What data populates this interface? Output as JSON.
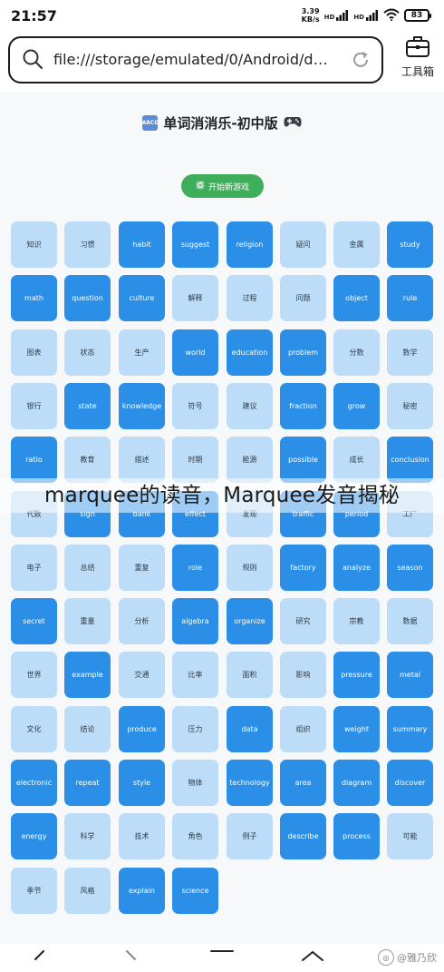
{
  "status_bar": {
    "time": "21:57",
    "net_speed_value": "3.39",
    "net_speed_unit": "KB/s",
    "signal_1": "HD",
    "signal_2": "HD",
    "battery": "83"
  },
  "browser": {
    "url": "file:///storage/emulated/0/Android/d…",
    "toolbox_label": "工具箱"
  },
  "page": {
    "title": "单词消消乐-初中版",
    "abc_icon_text": "ABCD",
    "new_game_label": "开始新游戏"
  },
  "colors": {
    "card_light": "#bddcf7",
    "card_blue": "#2b8fe8",
    "new_game_green": "#3fae5a"
  },
  "grid": {
    "rows": [
      [
        {
          "t": "知识",
          "s": "light"
        },
        {
          "t": "习惯",
          "s": "light"
        },
        {
          "t": "habit",
          "s": "blue"
        },
        {
          "t": "suggest",
          "s": "blue"
        },
        {
          "t": "religion",
          "s": "blue"
        },
        {
          "t": "疑问",
          "s": "light"
        },
        {
          "t": "金属",
          "s": "light"
        },
        {
          "t": "study",
          "s": "blue"
        }
      ],
      [
        {
          "t": "math",
          "s": "blue"
        },
        {
          "t": "question",
          "s": "blue"
        },
        {
          "t": "culture",
          "s": "blue"
        },
        {
          "t": "解释",
          "s": "light"
        },
        {
          "t": "过程",
          "s": "light"
        },
        {
          "t": "问题",
          "s": "light"
        },
        {
          "t": "object",
          "s": "blue"
        },
        {
          "t": "rule",
          "s": "blue"
        }
      ],
      [
        {
          "t": "图表",
          "s": "light"
        },
        {
          "t": "状态",
          "s": "light"
        },
        {
          "t": "生产",
          "s": "light"
        },
        {
          "t": "world",
          "s": "blue"
        },
        {
          "t": "education",
          "s": "blue"
        },
        {
          "t": "problem",
          "s": "blue"
        },
        {
          "t": "分数",
          "s": "light"
        },
        {
          "t": "数学",
          "s": "light"
        }
      ],
      [
        {
          "t": "银行",
          "s": "light"
        },
        {
          "t": "state",
          "s": "blue"
        },
        {
          "t": "knowledge",
          "s": "blue"
        },
        {
          "t": "符号",
          "s": "light"
        },
        {
          "t": "建议",
          "s": "light"
        },
        {
          "t": "fraction",
          "s": "blue"
        },
        {
          "t": "grow",
          "s": "blue"
        },
        {
          "t": "秘密",
          "s": "light"
        }
      ],
      [
        {
          "t": "ratio",
          "s": "blue"
        },
        {
          "t": "教育",
          "s": "light"
        },
        {
          "t": "描述",
          "s": "light"
        },
        {
          "t": "时期",
          "s": "light"
        },
        {
          "t": "能源",
          "s": "light"
        },
        {
          "t": "possible",
          "s": "blue"
        },
        {
          "t": "成长",
          "s": "light"
        },
        {
          "t": "conclusion",
          "s": "blue"
        }
      ],
      [
        {
          "t": "代数",
          "s": "light"
        },
        {
          "t": "sign",
          "s": "blue"
        },
        {
          "t": "bank",
          "s": "blue"
        },
        {
          "t": "effect",
          "s": "blue"
        },
        {
          "t": "发现",
          "s": "light"
        },
        {
          "t": "traffic",
          "s": "blue"
        },
        {
          "t": "period",
          "s": "blue"
        },
        {
          "t": "工厂",
          "s": "light"
        }
      ],
      [
        {
          "t": "电子",
          "s": "light"
        },
        {
          "t": "总结",
          "s": "light"
        },
        {
          "t": "重复",
          "s": "light"
        },
        {
          "t": "role",
          "s": "blue"
        },
        {
          "t": "规则",
          "s": "light"
        },
        {
          "t": "factory",
          "s": "blue"
        },
        {
          "t": "analyze",
          "s": "blue"
        },
        {
          "t": "season",
          "s": "blue"
        }
      ],
      [
        {
          "t": "secret",
          "s": "blue"
        },
        {
          "t": "重量",
          "s": "light"
        },
        {
          "t": "分析",
          "s": "light"
        },
        {
          "t": "algebra",
          "s": "blue"
        },
        {
          "t": "organize",
          "s": "blue"
        },
        {
          "t": "研究",
          "s": "light"
        },
        {
          "t": "宗教",
          "s": "light"
        },
        {
          "t": "数据",
          "s": "light"
        }
      ],
      [
        {
          "t": "世界",
          "s": "light"
        },
        {
          "t": "example",
          "s": "blue"
        },
        {
          "t": "交通",
          "s": "light"
        },
        {
          "t": "比率",
          "s": "light"
        },
        {
          "t": "面积",
          "s": "light"
        },
        {
          "t": "影响",
          "s": "light"
        },
        {
          "t": "pressure",
          "s": "blue"
        },
        {
          "t": "metal",
          "s": "blue"
        }
      ],
      [
        {
          "t": "文化",
          "s": "light"
        },
        {
          "t": "结论",
          "s": "light"
        },
        {
          "t": "produce",
          "s": "blue"
        },
        {
          "t": "压力",
          "s": "light"
        },
        {
          "t": "data",
          "s": "blue"
        },
        {
          "t": "组织",
          "s": "light"
        },
        {
          "t": "weight",
          "s": "blue"
        },
        {
          "t": "summary",
          "s": "blue"
        }
      ],
      [
        {
          "t": "electronic",
          "s": "blue"
        },
        {
          "t": "repeat",
          "s": "blue"
        },
        {
          "t": "style",
          "s": "blue"
        },
        {
          "t": "物体",
          "s": "light"
        },
        {
          "t": "technology",
          "s": "blue"
        },
        {
          "t": "area",
          "s": "blue"
        },
        {
          "t": "diagram",
          "s": "blue"
        },
        {
          "t": "discover",
          "s": "blue"
        }
      ],
      [
        {
          "t": "energy",
          "s": "blue"
        },
        {
          "t": "科学",
          "s": "light"
        },
        {
          "t": "技术",
          "s": "light"
        },
        {
          "t": "角色",
          "s": "light"
        },
        {
          "t": "例子",
          "s": "light"
        },
        {
          "t": "describe",
          "s": "blue"
        },
        {
          "t": "process",
          "s": "blue"
        },
        {
          "t": "可能",
          "s": "light"
        }
      ],
      [
        {
          "t": "季节",
          "s": "light"
        },
        {
          "t": "风格",
          "s": "light"
        },
        {
          "t": "explain",
          "s": "blue"
        },
        {
          "t": "science",
          "s": "blue"
        }
      ]
    ]
  },
  "overlay": {
    "text": "marquee的读音，Marquee发音揭秘"
  },
  "watermark": {
    "text": "@雅乃欣"
  }
}
